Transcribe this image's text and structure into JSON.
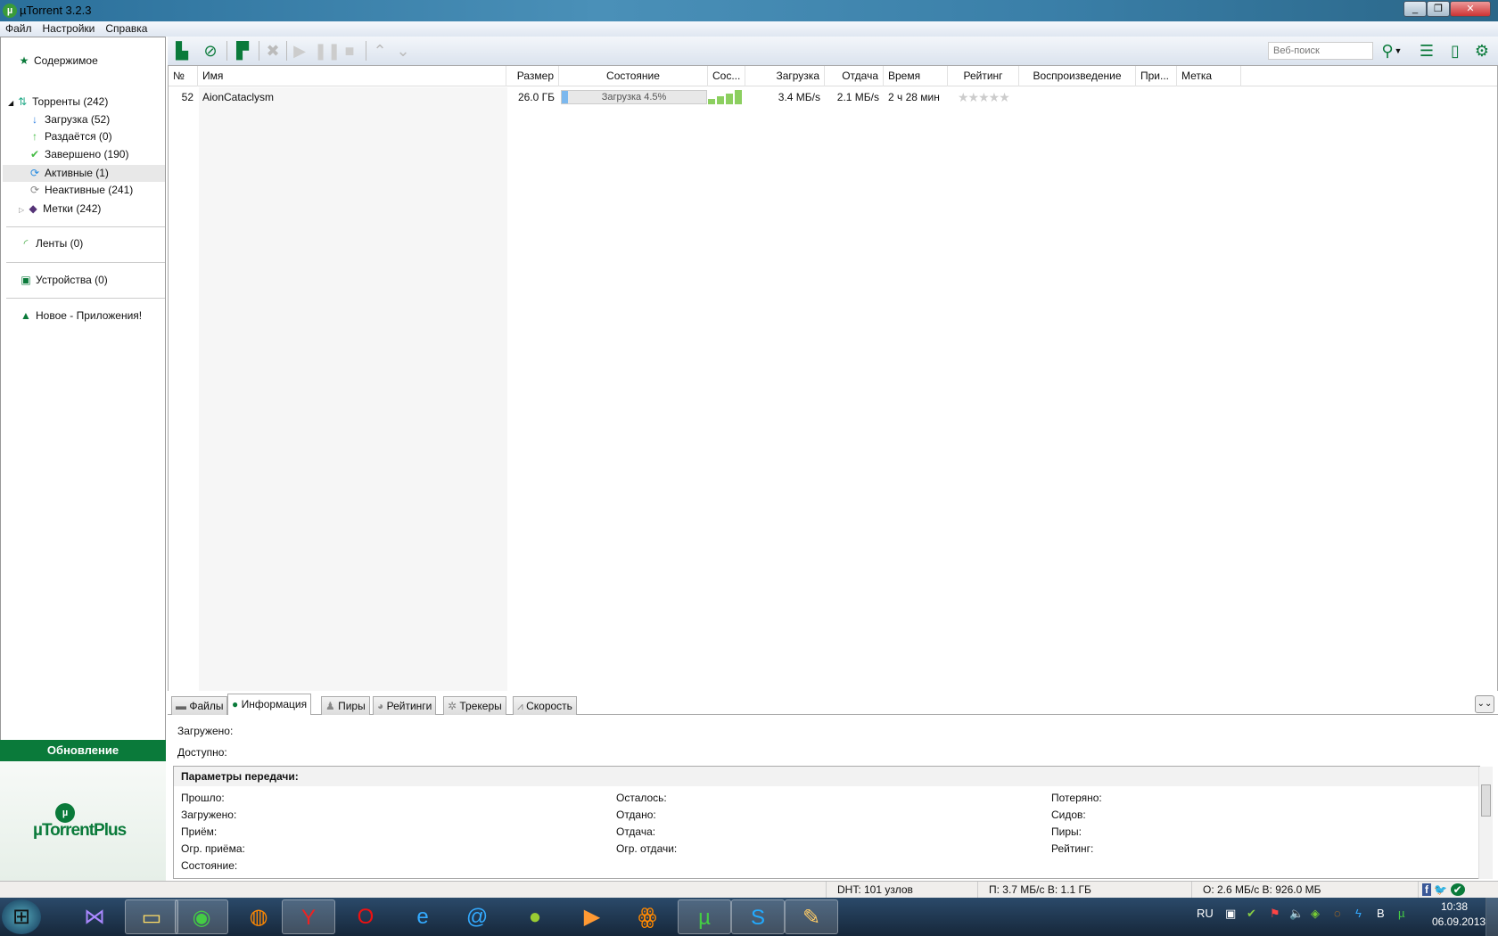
{
  "window": {
    "title": "µTorrent 3.2.3",
    "logo": "µ"
  },
  "menu": [
    "Файл",
    "Настройки",
    "Справка"
  ],
  "sidebar": {
    "content": "Содержимое",
    "torrents": "Торренты (242)",
    "downloading": "Загрузка (52)",
    "seeding": "Раздаётся (0)",
    "completed": "Завершено (190)",
    "active": "Активные (1)",
    "inactive": "Неактивные (241)",
    "labels": "Метки (242)",
    "feeds": "Ленты (0)",
    "devices": "Устройства (0)",
    "apps": "Новое - Приложения!",
    "update": "Обновление",
    "plus_logo": "µTorrentPlus"
  },
  "toolbar": {
    "search_placeholder": "Веб-поиск"
  },
  "columns": [
    "№",
    "Имя",
    "Размер",
    "Состояние",
    "Сос...",
    "Загрузка",
    "Отдача",
    "Время",
    "Рейтинг",
    "Воспроизведение",
    "При...",
    "Метка"
  ],
  "torrent": {
    "num": "52",
    "name": "AionCataclysm",
    "size": "26.0 ГБ",
    "status": "Загрузка 4.5%",
    "progress_pct": 4.5,
    "down": "3.4 МБ/s",
    "up": "2.1 МБ/s",
    "eta": "2 ч 28 мин",
    "rating": "★★★★★"
  },
  "tabs": [
    "Файлы",
    "Информация",
    "Пиры",
    "Рейтинги",
    "Трекеры",
    "Скорость"
  ],
  "info": {
    "downloaded": "Загружено:",
    "available": "Доступно:",
    "params_title": "Параметры передачи:",
    "col1": [
      "Прошло:",
      "Загружено:",
      "Приём:",
      "Огр. приёма:",
      "Состояние:"
    ],
    "col2": [
      "Осталось:",
      "Отдано:",
      "Отдача:",
      "Огр. отдачи:"
    ],
    "col3": [
      "Потеряно:",
      "Сидов:",
      "Пиры:",
      "Рейтинг:"
    ]
  },
  "status": {
    "dht": "DHT: 101 узлов",
    "down": "П: 3.7 МБ/с В: 1.1 ГБ",
    "up": "О: 2.6 МБ/с В: 926.0 МБ"
  },
  "tray": {
    "lang": "RU",
    "time": "10:38",
    "date": "06.09.2013"
  }
}
